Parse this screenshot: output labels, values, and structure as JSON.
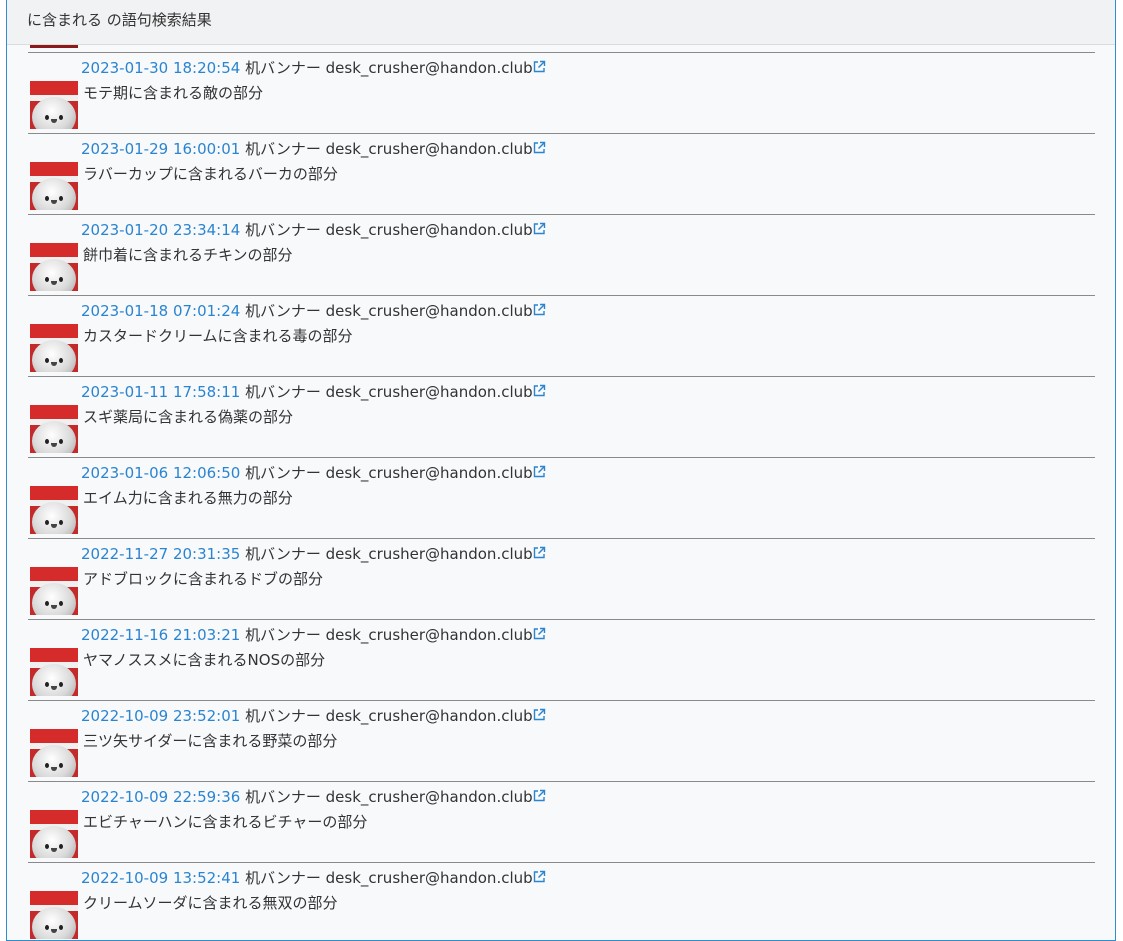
{
  "header": {
    "title": "に含まれる の語句検索結果"
  },
  "posts": [
    {
      "timestamp": "2023-01-30 18:20:54",
      "display_name": "机バンナー",
      "handle": "desk_crusher@handon.club",
      "text": "モテ期に含まれる敵の部分"
    },
    {
      "timestamp": "2023-01-29 16:00:01",
      "display_name": "机バンナー",
      "handle": "desk_crusher@handon.club",
      "text": "ラバーカップに含まれるバーカの部分"
    },
    {
      "timestamp": "2023-01-20 23:34:14",
      "display_name": "机バンナー",
      "handle": "desk_crusher@handon.club",
      "text": "餅巾着に含まれるチキンの部分"
    },
    {
      "timestamp": "2023-01-18 07:01:24",
      "display_name": "机バンナー",
      "handle": "desk_crusher@handon.club",
      "text": "カスタードクリームに含まれる毒の部分"
    },
    {
      "timestamp": "2023-01-11 17:58:11",
      "display_name": "机バンナー",
      "handle": "desk_crusher@handon.club",
      "text": "スギ薬局に含まれる偽薬の部分"
    },
    {
      "timestamp": "2023-01-06 12:06:50",
      "display_name": "机バンナー",
      "handle": "desk_crusher@handon.club",
      "text": "エイム力に含まれる無力の部分"
    },
    {
      "timestamp": "2022-11-27 20:31:35",
      "display_name": "机バンナー",
      "handle": "desk_crusher@handon.club",
      "text": "アドブロックに含まれるドブの部分"
    },
    {
      "timestamp": "2022-11-16 21:03:21",
      "display_name": "机バンナー",
      "handle": "desk_crusher@handon.club",
      "text": "ヤマノススメに含まれるNOSの部分"
    },
    {
      "timestamp": "2022-10-09 23:52:01",
      "display_name": "机バンナー",
      "handle": "desk_crusher@handon.club",
      "text": "三ツ矢サイダーに含まれる野菜の部分"
    },
    {
      "timestamp": "2022-10-09 22:59:36",
      "display_name": "机バンナー",
      "handle": "desk_crusher@handon.club",
      "text": "エビチャーハンに含まれるビチャーの部分"
    },
    {
      "timestamp": "2022-10-09 13:52:41",
      "display_name": "机バンナー",
      "handle": "desk_crusher@handon.club",
      "text": "クリームソーダに含まれる無双の部分"
    }
  ],
  "icons": {
    "external_link": "external-link-icon",
    "avatar": "avatar"
  },
  "colors": {
    "link": "#2b84d0",
    "border_accent": "#2f8fce",
    "panel_bg": "#f7f9fb",
    "divider": "#8a8a8a"
  }
}
